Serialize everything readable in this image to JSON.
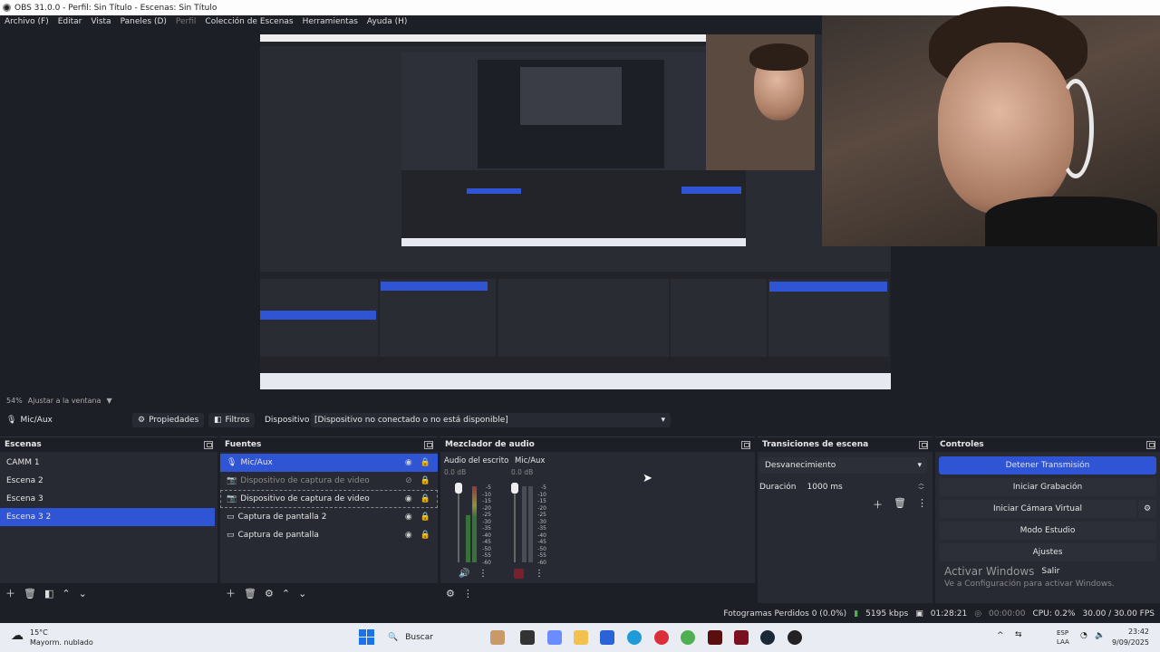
{
  "window": {
    "title": "OBS 31.0.0 - Perfil: Sin Título - Escenas: Sin Título"
  },
  "menu": [
    {
      "label": "Archivo (F)",
      "enabled": true
    },
    {
      "label": "Editar",
      "enabled": true
    },
    {
      "label": "Vista",
      "enabled": true
    },
    {
      "label": "Paneles (D)",
      "enabled": true
    },
    {
      "label": "Perfil",
      "enabled": false
    },
    {
      "label": "Colección de Escenas",
      "enabled": true
    },
    {
      "label": "Herramientas",
      "enabled": true
    },
    {
      "label": "Ayuda (H)",
      "enabled": true
    }
  ],
  "zoom": {
    "percent": "54%",
    "fit_label": "Ajustar a la ventana"
  },
  "source_toolbar": {
    "source_name": "Mic/Aux",
    "properties_label": "Propiedades",
    "filters_label": "Filtros",
    "device_label": "Dispositivo",
    "device_value": "[Dispositivo no conectado o no está disponible]"
  },
  "scenes": {
    "title": "Escenas",
    "items": [
      {
        "label": "CAMM 1",
        "selected": false
      },
      {
        "label": "Escena 2",
        "selected": false
      },
      {
        "label": "Escena 3",
        "selected": false
      },
      {
        "label": "Escena 3 2",
        "selected": true
      }
    ]
  },
  "sources": {
    "title": "Fuentes",
    "items": [
      {
        "label": "Mic/Aux",
        "icon": "mic-icon",
        "selected": true,
        "visible": true
      },
      {
        "label": "Dispositivo de captura de video",
        "icon": "camera-icon",
        "selected": false,
        "visible": false
      },
      {
        "label": "Dispositivo de captura de video",
        "icon": "camera-icon",
        "selected": false,
        "visible": true
      },
      {
        "label": "Captura de pantalla 2",
        "icon": "monitor-icon",
        "selected": false,
        "visible": true
      },
      {
        "label": "Captura de pantalla",
        "icon": "monitor-icon",
        "selected": false,
        "visible": true
      }
    ]
  },
  "mixer": {
    "title": "Mezclador de audio",
    "channels": [
      {
        "name": "Audio del escrito",
        "db": "0.0 dB",
        "level": 0.62
      },
      {
        "name": "Mic/Aux",
        "db": "0.0 dB",
        "level": 0.0
      }
    ],
    "scale": [
      "-5",
      "-10",
      "-15",
      "-20",
      "-25",
      "-30",
      "-35",
      "-40",
      "-45",
      "-50",
      "-55",
      "-60"
    ]
  },
  "transitions": {
    "title": "Transiciones de escena",
    "selected": "Desvanecimiento",
    "duration_label": "Duración",
    "duration_value": "1000 ms"
  },
  "controls": {
    "title": "Controles",
    "buttons": [
      {
        "label": "Detener Transmisión",
        "primary": true
      },
      {
        "label": "Iniciar Grabación",
        "primary": false
      },
      {
        "label": "Iniciar Cámara Virtual",
        "primary": false
      },
      {
        "label": "Modo Estudio",
        "primary": false
      },
      {
        "label": "Ajustes",
        "primary": false
      }
    ],
    "exit_label": "Salir"
  },
  "watermark": {
    "title": "Activar Windows",
    "subtitle": "Ve a Configuración para activar Windows."
  },
  "status": {
    "dropped_frames": "Fotogramas Perdidos 0 (0.0%)",
    "bitrate": "5195 kbps",
    "stream_time": "01:28:21",
    "rec_time": "00:00:00",
    "cpu": "CPU: 0.2%",
    "fps": "30.00 / 30.00 FPS"
  },
  "taskbar": {
    "weather_temp": "15°C",
    "weather_desc": "Mayorm. nublado",
    "search_label": "Buscar",
    "lang_1": "ESP",
    "lang_2": "LAA",
    "time": "23:42",
    "date": "9/09/2025"
  },
  "colors": {
    "accent": "#2f55d4",
    "panel": "#272a33",
    "background": "#1d1f26"
  }
}
